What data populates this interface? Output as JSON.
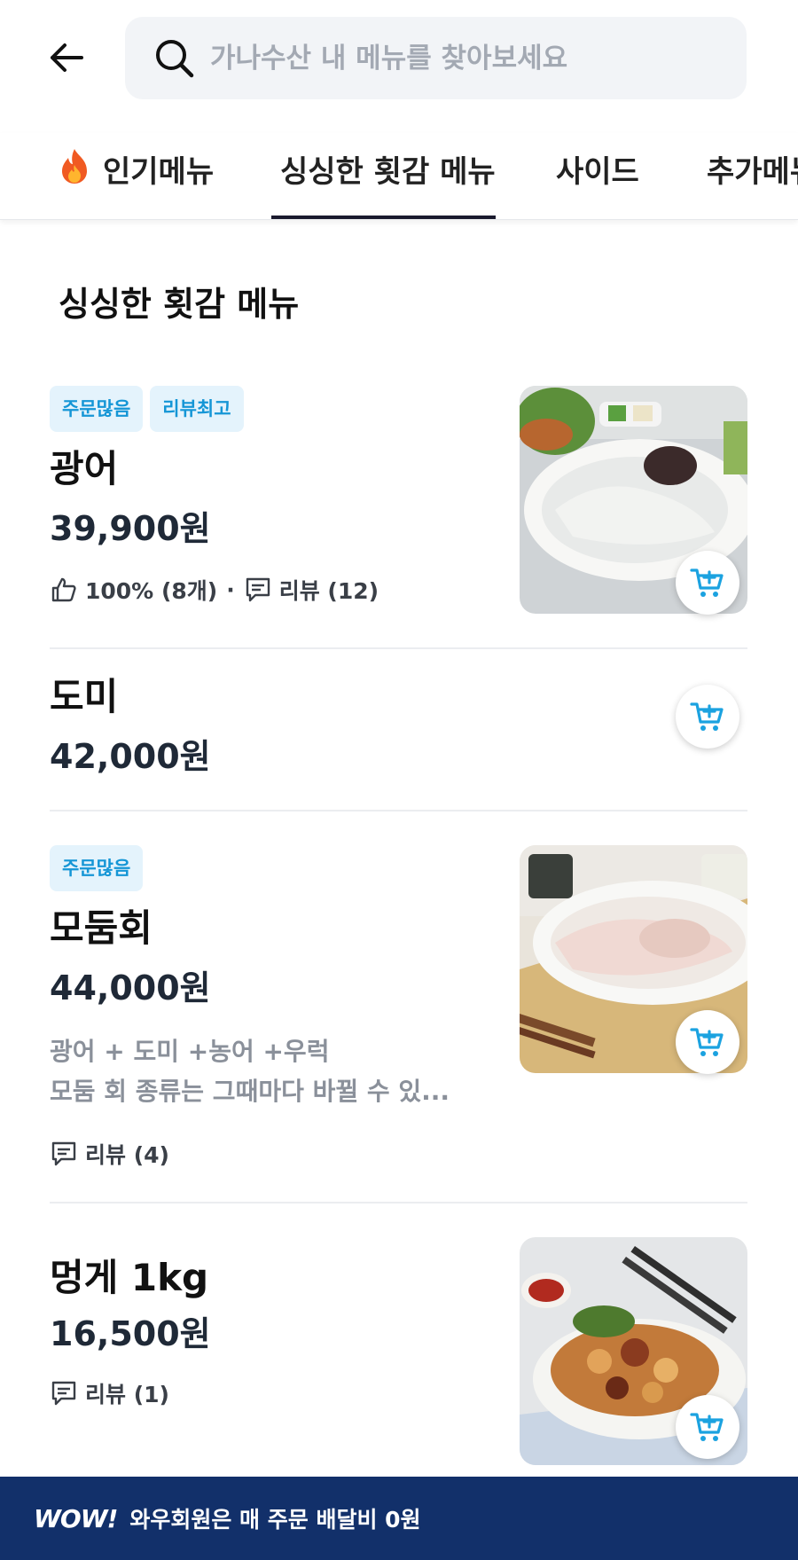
{
  "search": {
    "placeholder": "가나수산 내 메뉴를 찾아보세요"
  },
  "tabs": [
    {
      "label": "인기메뉴",
      "icon": "fire-icon"
    },
    {
      "label": "싱싱한 횟감 메뉴",
      "active": true
    },
    {
      "label": "사이드"
    },
    {
      "label": "추가메뉴"
    }
  ],
  "section": {
    "title": "싱싱한 횟감 메뉴"
  },
  "items": [
    {
      "badges": [
        "주문많음",
        "리뷰최고"
      ],
      "name": "광어",
      "price": "39,900원",
      "likes": "100% (8개)",
      "reviews": "리뷰 (12)"
    },
    {
      "name": "도미",
      "price": "42,000원"
    },
    {
      "badges": [
        "주문많음"
      ],
      "name": "모둠회",
      "price": "44,000원",
      "desc_line1": "광어 + 도미 +농어 +우럭",
      "desc_line2": "모둠 회 종류는 그때마다 바뀔 수 있...",
      "reviews": "리뷰 (4)"
    },
    {
      "name": "멍게 1kg",
      "price": "16,500원",
      "reviews": "리뷰 (1)"
    }
  ],
  "promo": {
    "logo": "WOW!",
    "text": "와우회원은 매 주문 배달비 0원"
  },
  "colors": {
    "accent": "#1596d6",
    "badge_bg": "#e4f3fc",
    "promo_bg": "#12306a",
    "tab_indicator": "#1a1a2e"
  }
}
